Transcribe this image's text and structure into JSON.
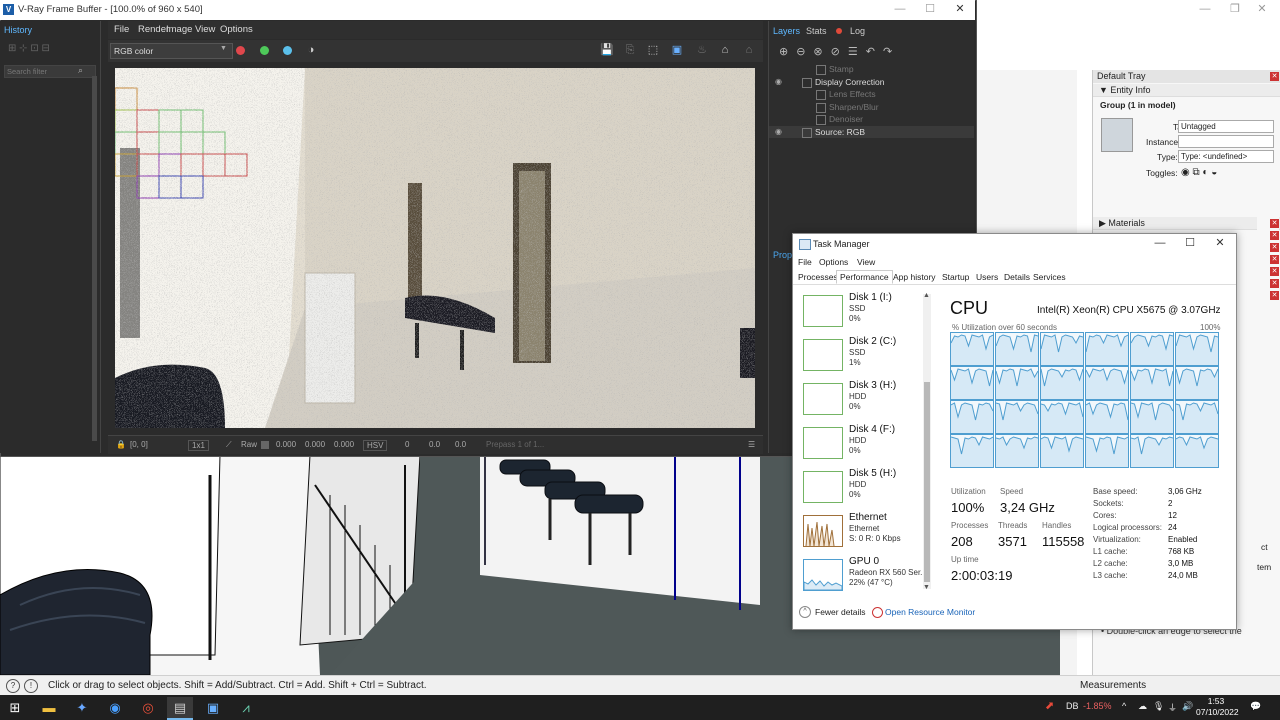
{
  "vfb": {
    "title": "V-Ray Frame Buffer - [100.0% of 960 x 540]",
    "menu": [
      "File",
      "Render",
      "Image",
      "View",
      "Options"
    ],
    "channel_select": "RGB color",
    "history_tab": "History",
    "search_placeholder": "Search filter",
    "layer_tabs": [
      "Layers",
      "Stats",
      "Log"
    ],
    "layers": [
      {
        "name": "Stamp",
        "visible": false
      },
      {
        "name": "Display Correction",
        "visible": true
      },
      {
        "name": "Lens Effects",
        "visible": false
      },
      {
        "name": "Sharpen/Blur",
        "visible": false
      },
      {
        "name": "Denoiser",
        "visible": false
      },
      {
        "name": "Source: RGB",
        "visible": true
      }
    ],
    "properties_label": "Prop",
    "bottom": {
      "coords": "[0, 0]",
      "zoom": "1x1",
      "mode": "Raw",
      "r": "0.000",
      "g": "0.000",
      "b": "0.000",
      "color_space": "HSV",
      "h": "0",
      "s": "0.0",
      "v": "0.0",
      "pass": "Prepass 1 of 1..."
    },
    "dot_colors": [
      "#e0474c",
      "#4ec95a",
      "#5bc0eb"
    ]
  },
  "sketchup": {
    "status_text": "Click or drag to select objects. Shift = Add/Subtract. Ctrl = Add. Shift + Ctrl = Subtract.",
    "measurements_label": "Measurements",
    "tray": {
      "title": "Default Tray",
      "section": "Entity Info",
      "entity": "Group (1 in model)",
      "tag_label": "Tag:",
      "tag_value": "Untagged",
      "instance_label": "Instance:",
      "type_label": "Type:",
      "type_value": "Type: <undefined>",
      "toggles_label": "Toggles:",
      "materials": "Materials",
      "hint": "Double-click an edge to select the",
      "hint_fragments": [
        "ct",
        "tem"
      ]
    }
  },
  "taskmanager": {
    "title": "Task Manager",
    "menu": [
      "File",
      "Options",
      "View"
    ],
    "tabs": [
      "Processes",
      "Performance",
      "App history",
      "Startup",
      "Users",
      "Details",
      "Services"
    ],
    "active_tab": "Performance",
    "devices": [
      {
        "name": "Disk 1 (I:)",
        "line1": "SSD",
        "line2": "0%"
      },
      {
        "name": "Disk 2 (C:)",
        "line1": "SSD",
        "line2": "1%"
      },
      {
        "name": "Disk 3 (H:)",
        "line1": "HDD",
        "line2": "0%"
      },
      {
        "name": "Disk 4 (F:)",
        "line1": "HDD",
        "line2": "0%"
      },
      {
        "name": "Disk 5 (H:)",
        "line1": "HDD",
        "line2": "0%"
      },
      {
        "name": "Ethernet",
        "line1": "Ethernet",
        "line2": "S: 0 R: 0 Kbps"
      },
      {
        "name": "GPU 0",
        "line1": "Radeon RX 560 Ser...",
        "line2": "22% (47 °C)"
      }
    ],
    "cpu": {
      "heading": "CPU",
      "model": "Intel(R) Xeon(R) CPU X5675 @ 3.07GHz",
      "util_caption": "% Utilization over 60 seconds",
      "util_max": "100%",
      "utilization_label": "Utilization",
      "utilization": "100%",
      "speed_label": "Speed",
      "speed": "3,24 GHz",
      "processes_label": "Processes",
      "processes": "208",
      "threads_label": "Threads",
      "threads": "3571",
      "handles_label": "Handles",
      "handles": "115558",
      "uptime_label": "Up time",
      "uptime": "2:00:03:19",
      "specs": [
        {
          "k": "Base speed:",
          "v": "3,06 GHz"
        },
        {
          "k": "Sockets:",
          "v": "2"
        },
        {
          "k": "Cores:",
          "v": "12"
        },
        {
          "k": "Logical processors:",
          "v": "24"
        },
        {
          "k": "Virtualization:",
          "v": "Enabled"
        },
        {
          "k": "L1 cache:",
          "v": "768 KB"
        },
        {
          "k": "L2 cache:",
          "v": "3,0 MB"
        },
        {
          "k": "L3 cache:",
          "v": "24,0 MB"
        }
      ]
    },
    "footer": {
      "fewer": "Fewer details",
      "monitor": "Open Resource Monitor"
    }
  },
  "taskbar": {
    "stock_label": "DB",
    "stock_change": "-1.85%",
    "time": "1:53",
    "date": "07/10/2022"
  }
}
